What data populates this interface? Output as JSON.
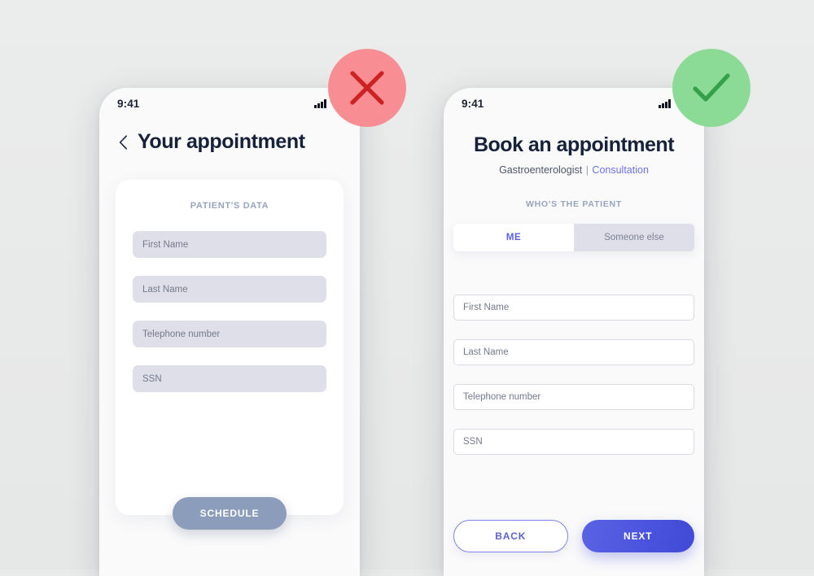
{
  "background_color": "#e9eaea",
  "accent_color": "#5b62e0",
  "badges": [
    {
      "name": "bad",
      "icon": "cross-icon",
      "circle_color": "#f98d94",
      "mark_color": "#cc2222"
    },
    {
      "name": "good",
      "icon": "check-icon",
      "circle_color": "#8bdb96",
      "mark_color": "#34a04a"
    }
  ],
  "bad_example": {
    "status_bar": {
      "time": "9:41",
      "signal_icon": "cellular-signal-icon",
      "wifi_icon": "wifi-icon"
    },
    "header": {
      "back_icon": "chevron-left-icon",
      "title": "Your appointment"
    },
    "card": {
      "section_label": "PATIENT'S DATA",
      "field_style": "filled-gray",
      "fields": [
        {
          "name": "first-name",
          "placeholder": "First Name",
          "value": ""
        },
        {
          "name": "last-name",
          "placeholder": "Last Name",
          "value": ""
        },
        {
          "name": "telephone-number",
          "placeholder": "Telephone number",
          "value": ""
        },
        {
          "name": "ssn",
          "placeholder": "SSN",
          "value": ""
        }
      ]
    },
    "primary_button": {
      "label": "SCHEDULE",
      "color": "#8c9dbb",
      "state": "disabled-look"
    }
  },
  "good_example": {
    "status_bar": {
      "time": "9:41",
      "signal_icon": "cellular-signal-icon",
      "wifi_icon": "wifi-icon"
    },
    "header": {
      "title": "Book an appointment",
      "subtitle_specialty": "Gastroenterologist",
      "subtitle_separator": "|",
      "subtitle_type": "Consultation",
      "subtitle_type_color": "#6b72e8"
    },
    "section_label": "WHO'S THE PATIENT",
    "segmented_control": {
      "options": [
        {
          "label": "ME",
          "selected": true
        },
        {
          "label": "Someone else",
          "selected": false
        }
      ]
    },
    "field_style": "outlined-white",
    "fields": [
      {
        "name": "first-name",
        "placeholder": "First Name",
        "value": ""
      },
      {
        "name": "last-name",
        "placeholder": "Last Name",
        "value": ""
      },
      {
        "name": "telephone-number",
        "placeholder": "Telephone number",
        "value": ""
      },
      {
        "name": "ssn",
        "placeholder": "SSN",
        "value": ""
      }
    ],
    "actions": {
      "back_label": "BACK",
      "next_label": "NEXT",
      "next_color": "#4b54dd"
    }
  }
}
